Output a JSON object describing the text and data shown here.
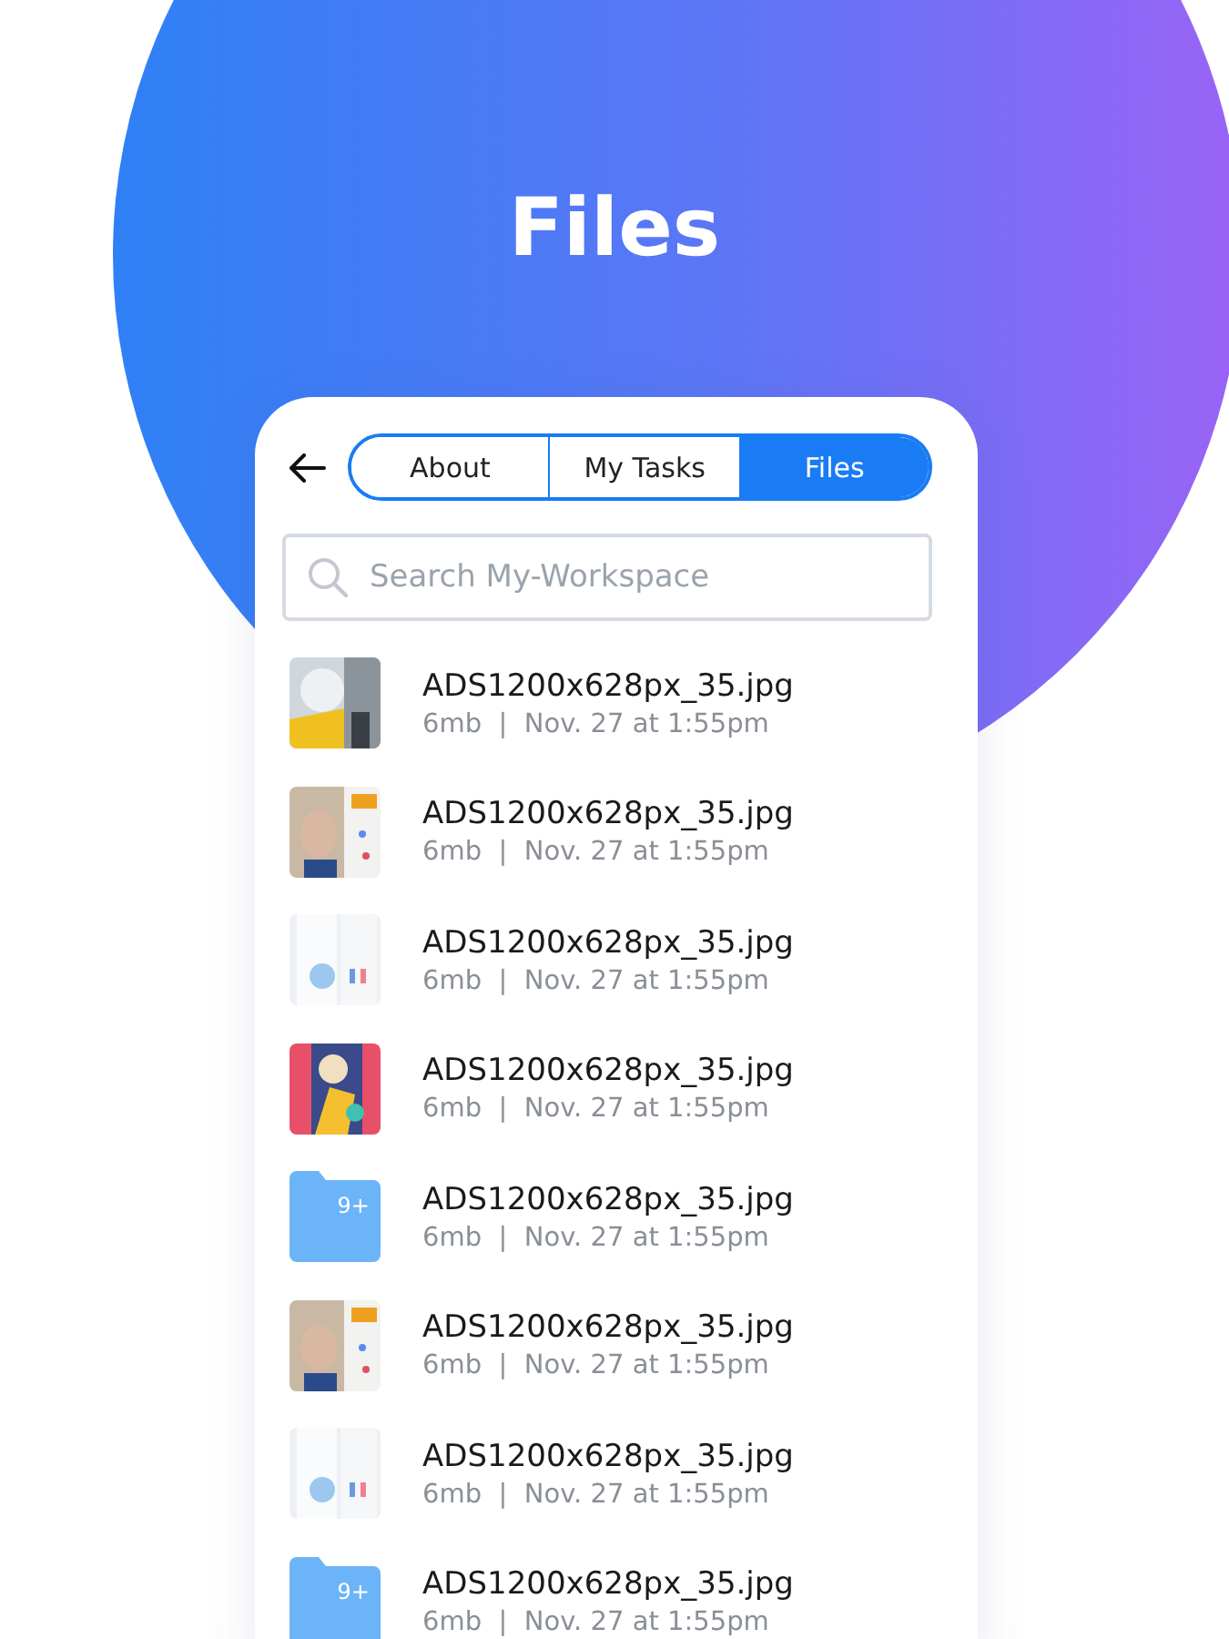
{
  "title": "Files",
  "tabs": [
    {
      "label": "About",
      "selected": false
    },
    {
      "label": "My Tasks",
      "selected": false
    },
    {
      "label": "Files",
      "selected": true
    }
  ],
  "search": {
    "placeholder": "Search My-Workspace"
  },
  "files": [
    {
      "name": "ADS1200x628px_35.jpg",
      "meta": "6mb  |  Nov. 27 at 1:55pm"
    },
    {
      "name": "ADS1200x628px_35.jpg",
      "meta": "6mb  |  Nov. 27 at 1:55pm"
    },
    {
      "name": "ADS1200x628px_35.jpg",
      "meta": "6mb  |  Nov. 27 at 1:55pm"
    },
    {
      "name": "ADS1200x628px_35.jpg",
      "meta": "6mb  |  Nov. 27 at 1:55pm"
    },
    {
      "kind": "folder",
      "badge": "9+",
      "name": "ADS1200x628px_35.jpg",
      "meta": "6mb  |  Nov. 27 at 1:55pm"
    },
    {
      "name": "ADS1200x628px_35.jpg",
      "meta": "6mb  |  Nov. 27 at 1:55pm"
    },
    {
      "name": "ADS1200x628px_35.jpg",
      "meta": "6mb  |  Nov. 27 at 1:55pm"
    },
    {
      "kind": "folder",
      "badge": "9+",
      "name": "ADS1200x628px_35.jpg",
      "meta": "6mb  |  Nov. 27 at 1:55pm"
    }
  ]
}
